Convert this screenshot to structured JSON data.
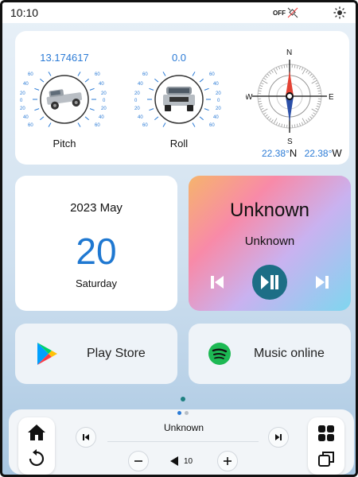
{
  "status_bar": {
    "time": "10:10",
    "gps_label": "OFF"
  },
  "gauges": {
    "pitch": {
      "value": "13.174617",
      "label": "Pitch"
    },
    "roll": {
      "value": "0.0",
      "label": "Roll"
    },
    "scale_left": [
      "60",
      "40",
      "20",
      "0",
      "20",
      "40",
      "60"
    ],
    "scale_right": [
      "60",
      "40",
      "20",
      "0",
      "20",
      "40",
      "60"
    ]
  },
  "compass": {
    "north": "N",
    "south": "S",
    "east": "E",
    "west": "W",
    "lat_value": "22.38°",
    "lat_dir": "N",
    "lon_value": "22.38°",
    "lon_dir": "W"
  },
  "date_card": {
    "year_month": "2023 May",
    "day": "20",
    "weekday": "Saturday"
  },
  "music_card": {
    "song": "Unknown",
    "artist": "Unknown"
  },
  "apps": [
    {
      "label": "Play Store",
      "icon": "play-store-icon"
    },
    {
      "label": "Music online",
      "icon": "spotify-icon"
    }
  ],
  "dock": {
    "track": "Unknown",
    "volume": "10"
  },
  "colors": {
    "accent_blue": "#2b7bd6",
    "play_teal": "#1d6e86",
    "page_dot": "#1e8080"
  }
}
